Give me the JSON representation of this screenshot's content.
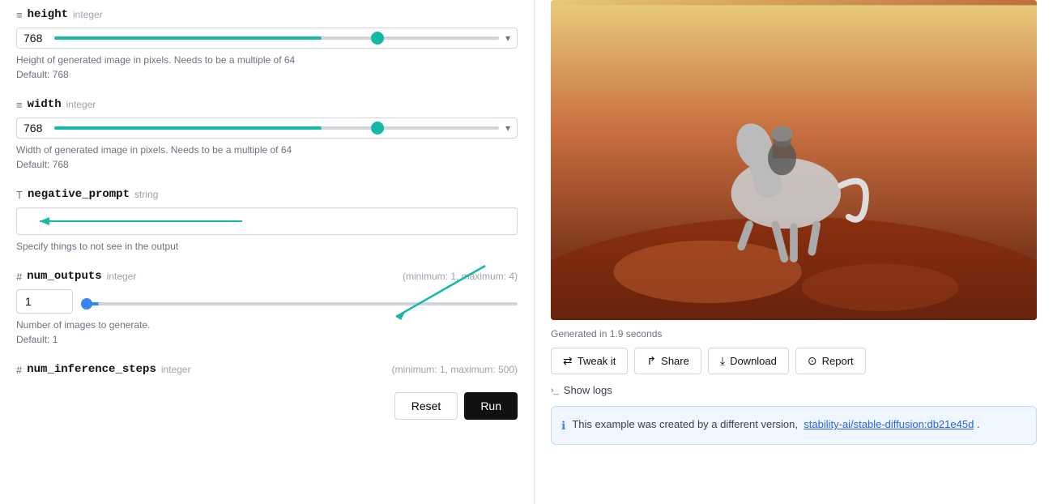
{
  "left": {
    "height_field": {
      "prefix": "≡",
      "name": "height",
      "type": "integer",
      "value": "768",
      "slider_percent": 60,
      "desc1": "Height of generated image in pixels. Needs to be a multiple of 64",
      "desc2": "Default: 768"
    },
    "width_field": {
      "prefix": "≡",
      "name": "width",
      "type": "integer",
      "value": "768",
      "slider_percent": 60,
      "desc1": "Width of generated image in pixels. Needs to be a multiple of 64",
      "desc2": "Default: 768"
    },
    "negative_prompt_field": {
      "prefix": "T",
      "name": "negative_prompt",
      "type": "string",
      "value": "",
      "placeholder": "",
      "desc": "Specify things to not see in the output"
    },
    "num_outputs_field": {
      "prefix": "#",
      "name": "num_outputs",
      "type": "integer",
      "constraint": "(minimum: 1, maximum: 4)",
      "value": "1",
      "desc1": "Number of images to generate.",
      "desc2": "Default: 1"
    },
    "num_inference_steps_field": {
      "prefix": "#",
      "name": "num_inference_steps",
      "type": "integer",
      "constraint": "(minimum: 1, maximum: 500)"
    },
    "buttons": {
      "reset": "Reset",
      "run": "Run"
    }
  },
  "right": {
    "gen_time": "Generated in 1.9 seconds",
    "actions": {
      "tweak": "Tweak it",
      "share": "Share",
      "download": "Download",
      "report": "Report"
    },
    "show_logs": "Show logs",
    "info_text": "This example was created by a different version, ",
    "info_link": "stability-ai/stable-diffusion:db21e45d",
    "info_link_suffix": "."
  }
}
